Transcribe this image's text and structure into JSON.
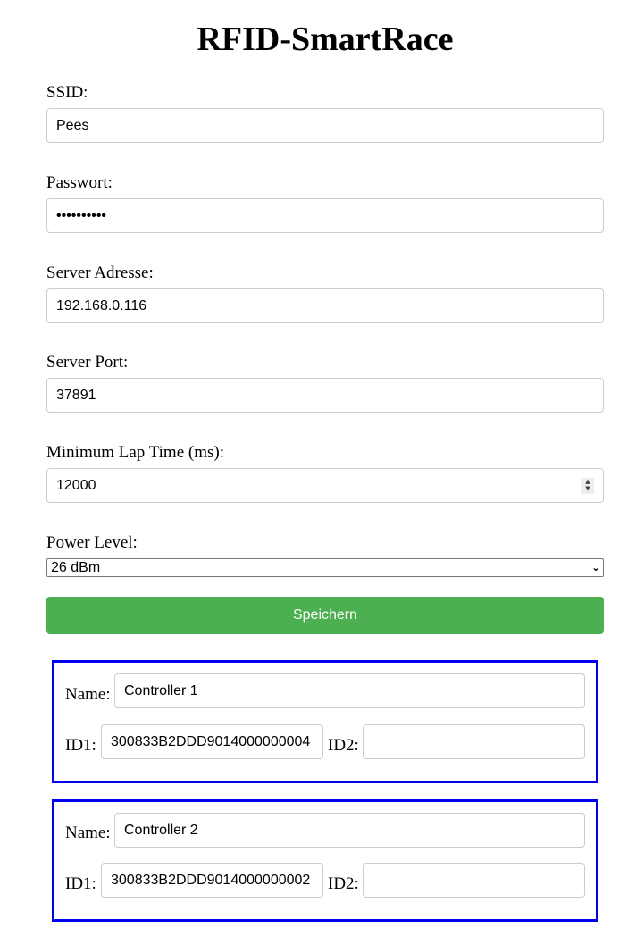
{
  "title": "RFID-SmartRace",
  "form": {
    "ssid_label": "SSID:",
    "ssid_value": "Pees",
    "password_label": "Passwort:",
    "password_value": "••••••••••",
    "server_label": "Server Adresse:",
    "server_value": "192.168.0.116",
    "port_label": "Server Port:",
    "port_value": "37891",
    "laptime_label": "Minimum Lap Time (ms):",
    "laptime_value": "12000",
    "power_label": "Power Level:",
    "power_value": "26 dBm",
    "save_label": "Speichern"
  },
  "controllers": [
    {
      "name_label": "Name:",
      "name": "Controller 1",
      "id1_label": "ID1:",
      "id1": "300833B2DDD9014000000004",
      "id2_label": "ID2:",
      "id2": ""
    },
    {
      "name_label": "Name:",
      "name": "Controller 2",
      "id1_label": "ID1:",
      "id1": "300833B2DDD9014000000002",
      "id2_label": "ID2:",
      "id2": ""
    }
  ],
  "colors": {
    "accent": "#4caf50",
    "box_border": "#0000ee"
  }
}
